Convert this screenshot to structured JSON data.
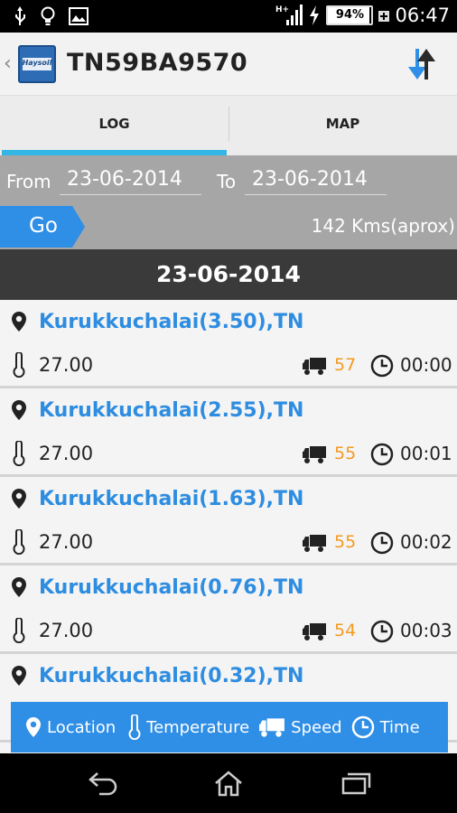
{
  "status_bar": {
    "battery": "94%",
    "battery_level": 0.94,
    "time": "06:47",
    "network_type": "H+"
  },
  "app_bar": {
    "back_icon": "chevron-left-icon",
    "logo_text": "Haysoil",
    "title": "TN59BA9570",
    "refresh_icon": "sync-arrows-icon"
  },
  "tabs": [
    {
      "label": "LOG",
      "active": true
    },
    {
      "label": "MAP",
      "active": false
    }
  ],
  "filter": {
    "from_label": "From",
    "from_value": "23-06-2014",
    "to_label": "To",
    "to_value": "23-06-2014",
    "go_label": "Go",
    "distance": "142 Kms(aprox)"
  },
  "date_header": "23-06-2014",
  "entries": [
    {
      "location": "Kurukkuchalai(3.50),TN",
      "temperature": "27.00",
      "speed": "57",
      "time": "00:00"
    },
    {
      "location": "Kurukkuchalai(2.55),TN",
      "temperature": "27.00",
      "speed": "55",
      "time": "00:01"
    },
    {
      "location": "Kurukkuchalai(1.63),TN",
      "temperature": "27.00",
      "speed": "55",
      "time": "00:02"
    },
    {
      "location": "Kurukkuchalai(0.76),TN",
      "temperature": "27.00",
      "speed": "54",
      "time": "00:03"
    },
    {
      "location": "Kurukkuchalai(0.32),TN",
      "temperature": "",
      "speed": "",
      "time": ""
    }
  ],
  "legend": {
    "location": "Location",
    "temperature": "Temperature",
    "speed": "Speed",
    "time": "Time"
  },
  "colors": {
    "accent": "#33b5e5",
    "location_text": "#2e8de0",
    "speed_text": "#f39a21",
    "legend_bg": "#2f8ee5",
    "go_button": "#2f8ee5"
  }
}
